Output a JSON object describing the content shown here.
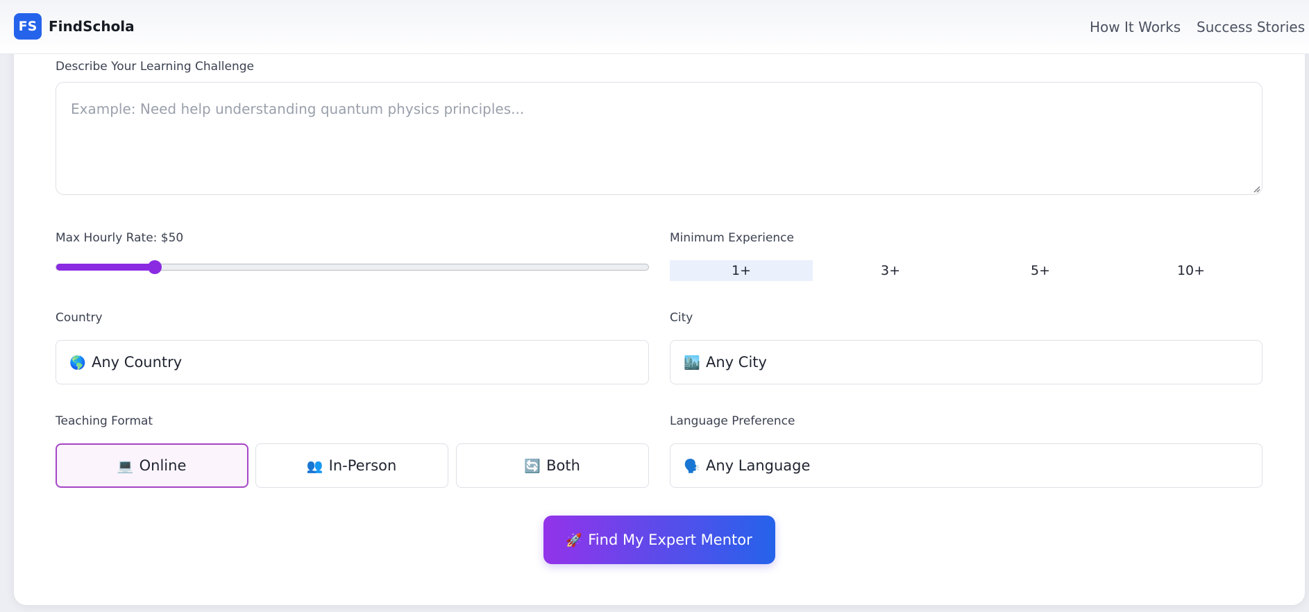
{
  "nav": {
    "logo": "FS",
    "brand": "FindSchola",
    "links": [
      "How It Works",
      "Success Stories"
    ]
  },
  "form": {
    "challenge_label": "Describe Your Learning Challenge",
    "challenge_placeholder": "Example: Need help understanding quantum physics principles...",
    "rate_label": "Max Hourly Rate: $50",
    "rate_slider": {
      "value": 50,
      "min": 0,
      "max": 300
    },
    "experience_label": "Minimum Experience",
    "experience_options": [
      "1+",
      "3+",
      "5+",
      "10+"
    ],
    "experience_selected": "1+",
    "country_label": "Country",
    "country_value": "Any Country",
    "country_icon": "🌎",
    "city_label": "City",
    "city_value": "Any City",
    "city_icon": "🏙️",
    "format_label": "Teaching Format",
    "format_options": [
      {
        "icon": "💻",
        "label": "Online"
      },
      {
        "icon": "👥",
        "label": "In-Person"
      },
      {
        "icon": "🔄",
        "label": "Both"
      }
    ],
    "format_selected": "Online",
    "language_label": "Language Preference",
    "language_value": "Any Language",
    "language_icon": "🗣️",
    "submit_icon": "🚀",
    "submit_label": "Find My Expert Mentor"
  },
  "colors": {
    "brand_blue": "#2563eb",
    "accent_purple": "#8a2be2",
    "selected_format_border": "#a544c4",
    "selected_experience_bg": "#eaf0fc"
  }
}
